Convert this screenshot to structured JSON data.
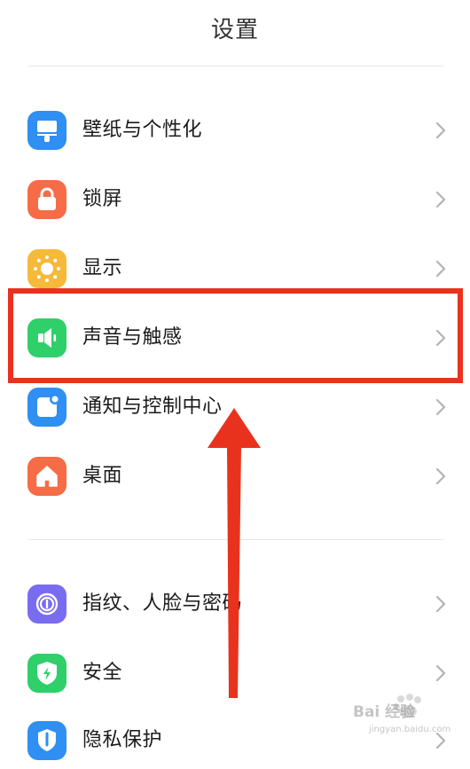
{
  "header": {
    "title": "设置"
  },
  "groups": [
    {
      "items": [
        {
          "label": "壁纸与个性化",
          "icon": "wallpaper-icon",
          "color": "#2f8ff2"
        },
        {
          "label": "锁屏",
          "icon": "lock-icon",
          "color": "#f56c46"
        },
        {
          "label": "显示",
          "icon": "brightness-icon",
          "color": "#f6b93a"
        },
        {
          "label": "声音与触感",
          "icon": "speaker-icon",
          "color": "#2fcf6a"
        },
        {
          "label": "通知与控制中心",
          "icon": "notification-icon",
          "color": "#2f8ff2"
        },
        {
          "label": "桌面",
          "icon": "home-icon",
          "color": "#f56c46"
        }
      ]
    },
    {
      "items": [
        {
          "label": "指纹、人脸与密码",
          "icon": "fingerprint-icon",
          "color": "#7a6cf0"
        },
        {
          "label": "安全",
          "icon": "shield-icon",
          "color": "#2fcf6a"
        },
        {
          "label": "隐私保护",
          "icon": "privacy-icon",
          "color": "#2f8ff2"
        }
      ]
    }
  ],
  "annotation": {
    "highlight_color": "#e9321e",
    "highlighted_item": "声音与触感"
  },
  "watermark": {
    "text": "Bai 经验",
    "sub": "jingyan.baidu.com"
  }
}
